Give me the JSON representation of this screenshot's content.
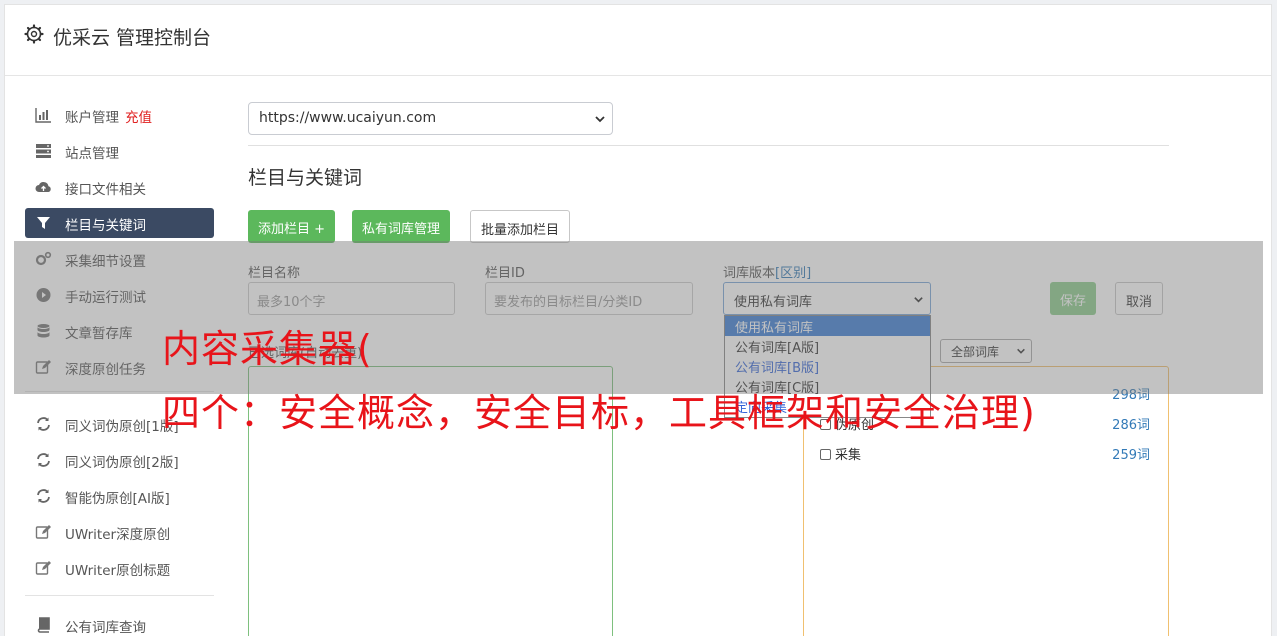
{
  "header": {
    "title": "优采云 管理控制台"
  },
  "sidebar": {
    "items": [
      {
        "label": "账户管理",
        "badge": "充值",
        "icon": "bar-chart-icon"
      },
      {
        "label": "站点管理",
        "icon": "server-icon"
      },
      {
        "label": "接口文件相关",
        "icon": "cloud-upload-icon"
      },
      {
        "label": "栏目与关键词",
        "icon": "filter-icon",
        "active": true
      },
      {
        "label": "采集细节设置",
        "icon": "cogs-icon"
      },
      {
        "label": "手动运行测试",
        "icon": "play-circle-icon"
      },
      {
        "label": "文章暂存库",
        "icon": "database-icon"
      },
      {
        "label": "深度原创任务",
        "icon": "edit-icon"
      },
      {
        "label": "同义词伪原创[1版]",
        "icon": "refresh-icon"
      },
      {
        "label": "同义词伪原创[2版]",
        "icon": "refresh-icon"
      },
      {
        "label": "智能伪原创[AI版]",
        "icon": "refresh-icon"
      },
      {
        "label": "UWriter深度原创",
        "icon": "edit-icon"
      },
      {
        "label": "UWriter原创标题",
        "icon": "edit-icon"
      },
      {
        "label": "公有词库查询",
        "icon": "book-icon"
      }
    ]
  },
  "main": {
    "site_select": {
      "value": "https://www.ucaiyun.com"
    },
    "section_title": "栏目与关键词",
    "buttons": {
      "add_column": "添加栏目 +",
      "private_lib": "私有词库管理",
      "batch_add": "批量添加栏目"
    },
    "form": {
      "name_label": "栏目名称",
      "name_placeholder": "最多10个字",
      "id_label": "栏目ID",
      "id_placeholder": "要发布的目标栏目/分类ID",
      "version_label": "词库版本",
      "version_diff": "[区别]",
      "version_value": "使用私有词库",
      "save": "保存",
      "cancel": "取消"
    },
    "dropdown_options": [
      "使用私有词库",
      "公有词库[A版]",
      "公有词库[B版]",
      "公有词库[C版]",
      "定向采集"
    ],
    "selected_libs_label": "已选词库(自动去重)",
    "filter_select": "全部词库",
    "libraries": [
      {
        "name": "",
        "count": "298词"
      },
      {
        "name": "伪原创",
        "count": "286词"
      },
      {
        "name": "采集",
        "count": "259词"
      }
    ]
  },
  "overlay": {
    "line1": "内容采集器(",
    "line2": "四个：安全概念，安全目标，工具框架和安全治理)"
  },
  "colors": {
    "active_bg": "#3b4a63",
    "green": "#5cb85c",
    "overlay_text": "#e8141a"
  }
}
